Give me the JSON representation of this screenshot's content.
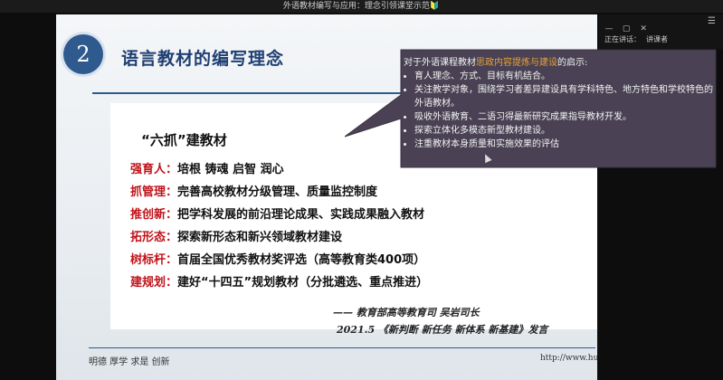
{
  "window": {
    "title": "外语教材编写与应用：理念引领课堂示范🔰"
  },
  "slide": {
    "number": "2",
    "title": "语言教材的编写理念",
    "heading": "“六抓”建教材",
    "items": [
      {
        "key": "强育人：",
        "text": "培根 铸魂 启智 润心"
      },
      {
        "key": "抓管理：",
        "text": "完善高校教材分级管理、质量监控制度"
      },
      {
        "key": "推创新：",
        "text": "把学科发展的前沿理论成果、实践成果融入教材"
      },
      {
        "key": "拓形态：",
        "text": "探索新形态和新兴领域教材建设"
      },
      {
        "key": "树标杆：",
        "text": "首届全国优秀教材奖评选（高等教育类400项）"
      },
      {
        "key": "建规划：",
        "text": "建好“十四五”规划教材（分批遴选、重点推进）"
      }
    ],
    "signature": "—— 教育部高等教育司 吴岩司长",
    "source": "2021.5 《新判断 新任务 新体系 新基建》发言",
    "footer_left": "明德 厚学 求是 创新",
    "footer_right": "http://www.hust.edu.cn/"
  },
  "callout": {
    "intro_prefix": "对于外语课程教材",
    "intro_highlight": "思政内容提炼与建设",
    "intro_suffix": "的启示:",
    "bullets": [
      "育人理念、方式、目标有机结合。",
      "关注教学对象，围绕学习者差异建设具有学科特色、地方特色和学校特色的外语教材。",
      "吸收外语教育、二语习得最新研究成果指导教材开发。",
      "探索立体化多模态新型教材建设。",
      "注重教材本身质量和实施效果的评估"
    ]
  },
  "side_panel": {
    "row": [
      "正在讲话：",
      "讲课者"
    ],
    "menu_icon": "hamburger-icon"
  },
  "colors": {
    "accent": "#2f5a8e",
    "keyword": "#c0131a",
    "callout_bg": "#4a4254",
    "highlight": "#e5a238"
  }
}
